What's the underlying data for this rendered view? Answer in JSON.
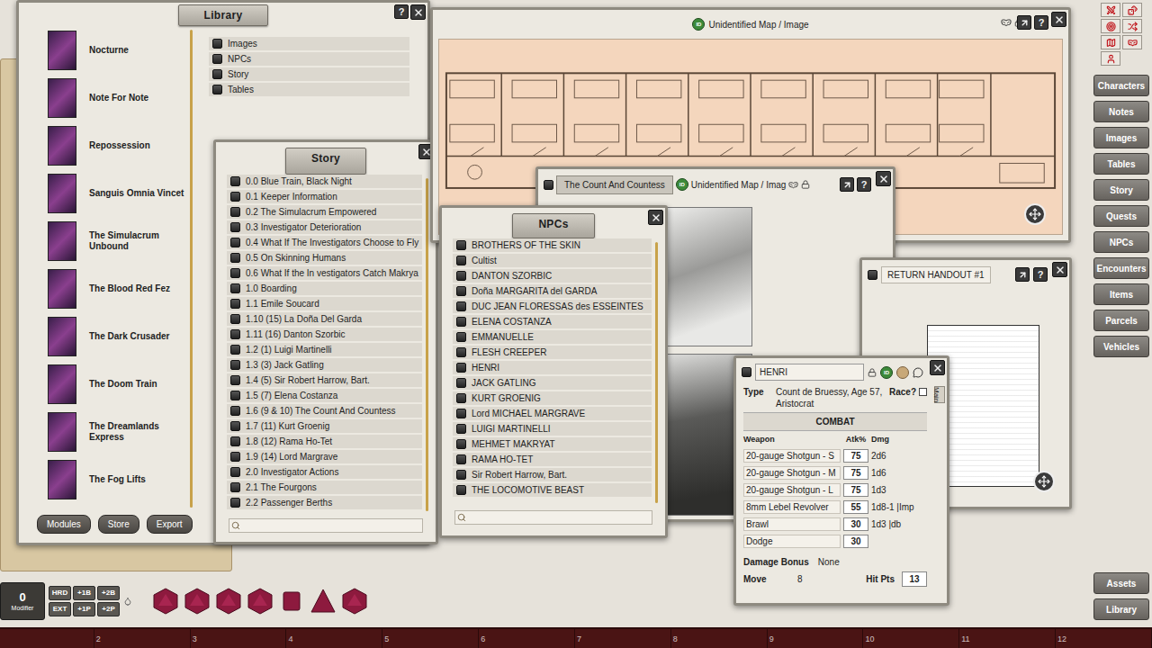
{
  "glyphs": {
    "help": "?",
    "id": "ID"
  },
  "library": {
    "title": "Library",
    "modules": [
      {
        "name": "Nocturne"
      },
      {
        "name": "Note For Note"
      },
      {
        "name": "Repossession"
      },
      {
        "name": "Sanguis Omnia Vincet"
      },
      {
        "name": "The Simulacrum Unbound"
      },
      {
        "name": "The Blood Red Fez"
      },
      {
        "name": "The Dark Crusader"
      },
      {
        "name": "The Doom Train"
      },
      {
        "name": "The Dreamlands Express"
      },
      {
        "name": "The Fog Lifts"
      }
    ],
    "categories": [
      "Images",
      "NPCs",
      "Story",
      "Tables"
    ],
    "buttons": [
      "Modules",
      "Store",
      "Export"
    ]
  },
  "story": {
    "title": "Story",
    "entries": [
      "0.0 Blue Train, Black Night",
      "0.1 Keeper Information",
      "0.2 The Simulacrum Empowered",
      "0.3 Investigator Deterioration",
      "0.4 What If The Investigators Choose to Fly",
      "0.5 On Skinning Humans",
      "0.6 What If the In vestigators Catch Makrya",
      "1.0 Boarding",
      "1.1 Emile Soucard",
      "1.10 (15) La Doña Del Garda",
      "1.11 (16) Danton Szorbic",
      "1.2 (1) Luigi Martinelli",
      "1.3 (3) Jack Gatling",
      "1.4 (5) Sir Robert Harrow, Bart.",
      "1.5 (7) Elena Costanza",
      "1.6 (9 & 10) The Count And Countess",
      "1.7 (11) Kurt Groenig",
      "1.8 (12) Rama Ho-Tet",
      "1.9 (14) Lord Margrave",
      "2.0 Investigator Actions",
      "2.1 The Fourgons",
      "2.2 Passenger Berths"
    ]
  },
  "npcs": {
    "title": "NPCs",
    "entries": [
      "BROTHERS OF THE SKIN",
      "Cultist",
      "DANTON SZORBIC",
      "Doña MARGARITA del GARDA",
      "DUC JEAN FLORESSAS des ESSEINTES",
      "ELENA COSTANZA",
      "EMMANUELLE",
      "FLESH CREEPER",
      "HENRI",
      "JACK GATLING",
      "KURT GROENIG",
      "Lord MICHAEL MARGRAVE",
      "LUIGI MARTINELLI",
      "MEHMET MAKRYAT",
      "RAMA HO-TET",
      "Sir Robert Harrow, Bart.",
      "THE LOCOMOTIVE BEAST"
    ]
  },
  "map_window": {
    "title": "Unidentified Map / Image"
  },
  "count_window": {
    "tab": "The Count And Countess",
    "title": "Unidentified Map / Imag"
  },
  "handout_window": {
    "title": "RETURN HANDOUT #1"
  },
  "npc_sheet": {
    "name": "HENRI",
    "type_label": "Type",
    "type": "Count de Bruessy, Age 57, Aristocrat",
    "race_label": "Race?",
    "race_checked": false,
    "section": "COMBAT",
    "columns": [
      "Weapon",
      "Atk%",
      "Dmg"
    ],
    "weapons": [
      {
        "name": "20-gauge Shotgun - S",
        "atk": "75",
        "dmg": "2d6"
      },
      {
        "name": "20-gauge Shotgun - M",
        "atk": "75",
        "dmg": "1d6"
      },
      {
        "name": "20-gauge Shotgun - L",
        "atk": "75",
        "dmg": "1d3"
      },
      {
        "name": "8mm Lebel Revolver",
        "atk": "55",
        "dmg": "1d8-1 |Imp"
      },
      {
        "name": "Brawl",
        "atk": "30",
        "dmg": "1d3 |db"
      },
      {
        "name": "Dodge",
        "atk": "30",
        "dmg": ""
      }
    ],
    "damage_bonus_label": "Damage Bonus",
    "damage_bonus": "None",
    "move_label": "Move",
    "move": "8",
    "hp_label": "Hit Pts",
    "hp": "13",
    "tabs": [
      "Main"
    ]
  },
  "sidebar": {
    "buttons": [
      "Characters",
      "Notes",
      "Images",
      "Tables",
      "Story",
      "Quests",
      "NPCs",
      "Encounters",
      "Items",
      "Parcels",
      "Vehicles"
    ],
    "bottom_buttons": [
      "Assets",
      "Library"
    ]
  },
  "modifier": {
    "value": "0",
    "label": "Modifier"
  },
  "dice_buttons": [
    "HRD",
    "+1B",
    "+2B",
    "EXT",
    "+1P",
    "+2P"
  ],
  "hotkeys": [
    "2",
    "3",
    "4",
    "5",
    "6",
    "7",
    "8",
    "9",
    "10",
    "11",
    "12"
  ]
}
